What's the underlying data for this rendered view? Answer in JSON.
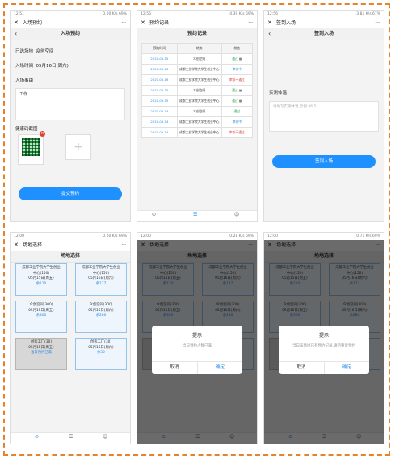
{
  "status": {
    "p1": {
      "time": "12:51",
      "net": "0.00 K/s",
      "battery": "69%"
    },
    "p2": {
      "time": "12:56",
      "net": "4.39 K/s",
      "battery": "69%"
    },
    "p3": {
      "time": "12:56",
      "net": "3.81 K/s",
      "battery": "67%"
    },
    "p4": {
      "time": "12:00",
      "net": "0.00 K/s",
      "battery": "69%"
    },
    "p5": {
      "time": "12:00",
      "net": "0.28 K/s",
      "battery": "69%"
    },
    "p6": {
      "time": "12:00",
      "net": "0.71 K/s",
      "battery": "69%"
    }
  },
  "entry": {
    "title": "入场预约",
    "header": "入场预约",
    "venue_label": "已选场地",
    "venue_value": "众创空间",
    "time_label": "入场时间",
    "time_value": "05月16日(周六)",
    "reason_label": "入场事由",
    "reason_value": "工作",
    "health_label": "健康码截图",
    "submit": "提交预约"
  },
  "records": {
    "title": "预约记录",
    "header": "预约记录",
    "columns": [
      "预约时间",
      "地点",
      "状态"
    ],
    "rows": [
      {
        "date": "2020-05-15",
        "place": "众创空间",
        "status": "通过",
        "kind": "green",
        "qr": true
      },
      {
        "date": "2020-05-16",
        "place": "成都工业学院大学生创业中心",
        "status": "审核中",
        "kind": "blue",
        "qr": false
      },
      {
        "date": "2020-05-16",
        "place": "成都工业学院大学生创业中心",
        "status": "审核不通过",
        "kind": "red",
        "qr": false
      },
      {
        "date": "2020-05-15",
        "place": "众创空间",
        "status": "通过",
        "kind": "green",
        "qr": true
      },
      {
        "date": "2020-05-15",
        "place": "成都工业学院大学生创业中心",
        "status": "通过",
        "kind": "green",
        "qr": true
      },
      {
        "date": "2020-05-14",
        "place": "众创空间",
        "status": "通过",
        "kind": "green",
        "qr": false
      },
      {
        "date": "2020-05-14",
        "place": "成都工业学院大学生创业中心",
        "status": "审核中",
        "kind": "blue",
        "qr": false
      },
      {
        "date": "2020-05-14",
        "place": "成都工业学院大学生创业中心",
        "status": "审核不通过",
        "kind": "red",
        "qr": false
      }
    ],
    "tabs": [
      "场地预约",
      "我的预约",
      "我的"
    ]
  },
  "checkin": {
    "title": "签到入场",
    "header": "签到入场",
    "temp_label": "实测体温",
    "temp_placeholder": "请填写实测体温,示例:36.5",
    "button": "签到入场"
  },
  "venue_select": {
    "title": "场地选择",
    "header": "场地选择",
    "cards": [
      {
        "l1": "成都工业学院大学生创业",
        "l2": "中心(150)",
        "l3": "05月15日(周五)",
        "l4": "余110",
        "grey": false
      },
      {
        "l1": "成都工业学院大学生创业",
        "l2": "中心(150)",
        "l3": "05月16日(周六)",
        "l4": "余127",
        "grey": false
      },
      {
        "l1": "众创空间(300)",
        "l2": "05月15日(周五)",
        "l3": "余300",
        "l4": "",
        "grey": false
      },
      {
        "l1": "众创空间(300)",
        "l2": "05月16日(周六)",
        "l3": "余286",
        "l4": "",
        "grey": false
      },
      {
        "l1": "创客工厂(30)",
        "l2": "05月15日(周五)",
        "l3": "当日预约已满",
        "l4": "",
        "grey": true
      },
      {
        "l1": "创客工厂(30)",
        "l2": "05月16日(周六)",
        "l3": "余30",
        "l4": "",
        "grey": false
      }
    ]
  },
  "modal1": {
    "title": "提示",
    "content": "当日预约人数已满",
    "cancel": "取消",
    "confirm": "确定"
  },
  "modal2": {
    "title": "提示",
    "content": "当日该场地已有预约记录,请勿重复预约",
    "cancel": "取消",
    "confirm": "确定"
  },
  "colors": {
    "accent": "#1e90ff",
    "pass": "#2aa84a",
    "reject": "#e0403a",
    "frame": "#e8822a"
  }
}
